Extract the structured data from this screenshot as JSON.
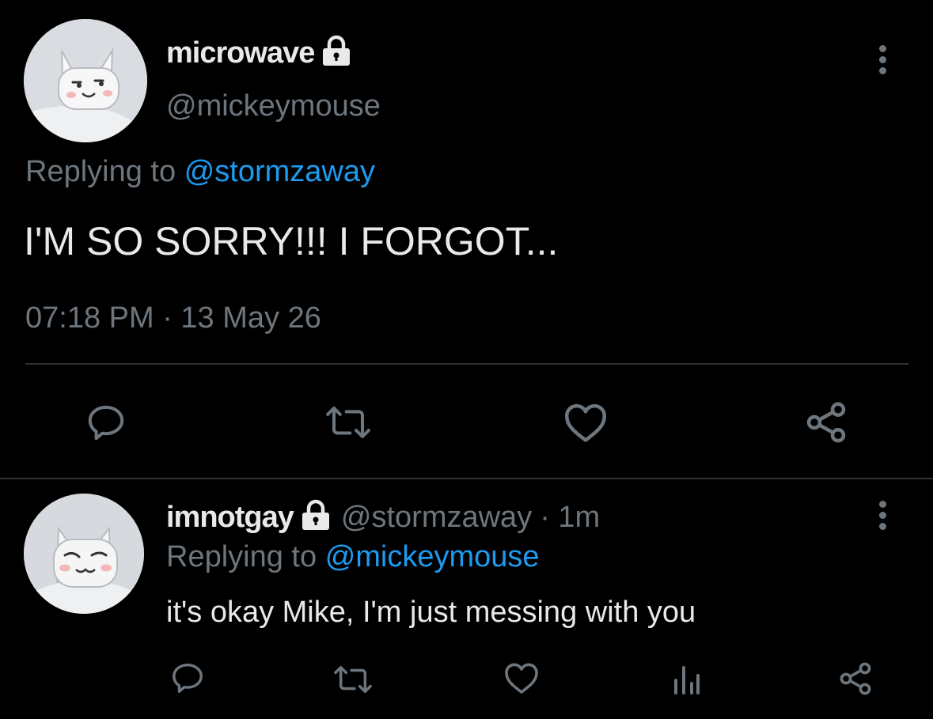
{
  "main_tweet": {
    "display_name": "microwave",
    "handle": "@mickeymouse",
    "replying_prefix": "Replying to",
    "replying_handle": "@stormzaway",
    "text": "I'M SO SORRY!!! I FORGOT...",
    "timestamp": "07:18 PM · 13 May 26"
  },
  "reply_tweet": {
    "display_name": "imnotgay",
    "handle": "@stormzaway",
    "separator_time": "· 1m",
    "replying_prefix": "Replying to",
    "replying_handle": "@mickeymouse",
    "text": "it's okay Mike, I'm just messing with you"
  },
  "icons": {
    "reply": "reply-icon",
    "retweet": "retweet-icon",
    "like": "heart-icon",
    "share": "share-icon",
    "analytics": "analytics-icon",
    "lock": "lock-icon",
    "more": "more-vertical-icon"
  },
  "colors": {
    "background": "#000000",
    "text": "#e7e9ea",
    "muted": "#6e767d",
    "link": "#1d9bf0",
    "divider": "#2f3336"
  }
}
